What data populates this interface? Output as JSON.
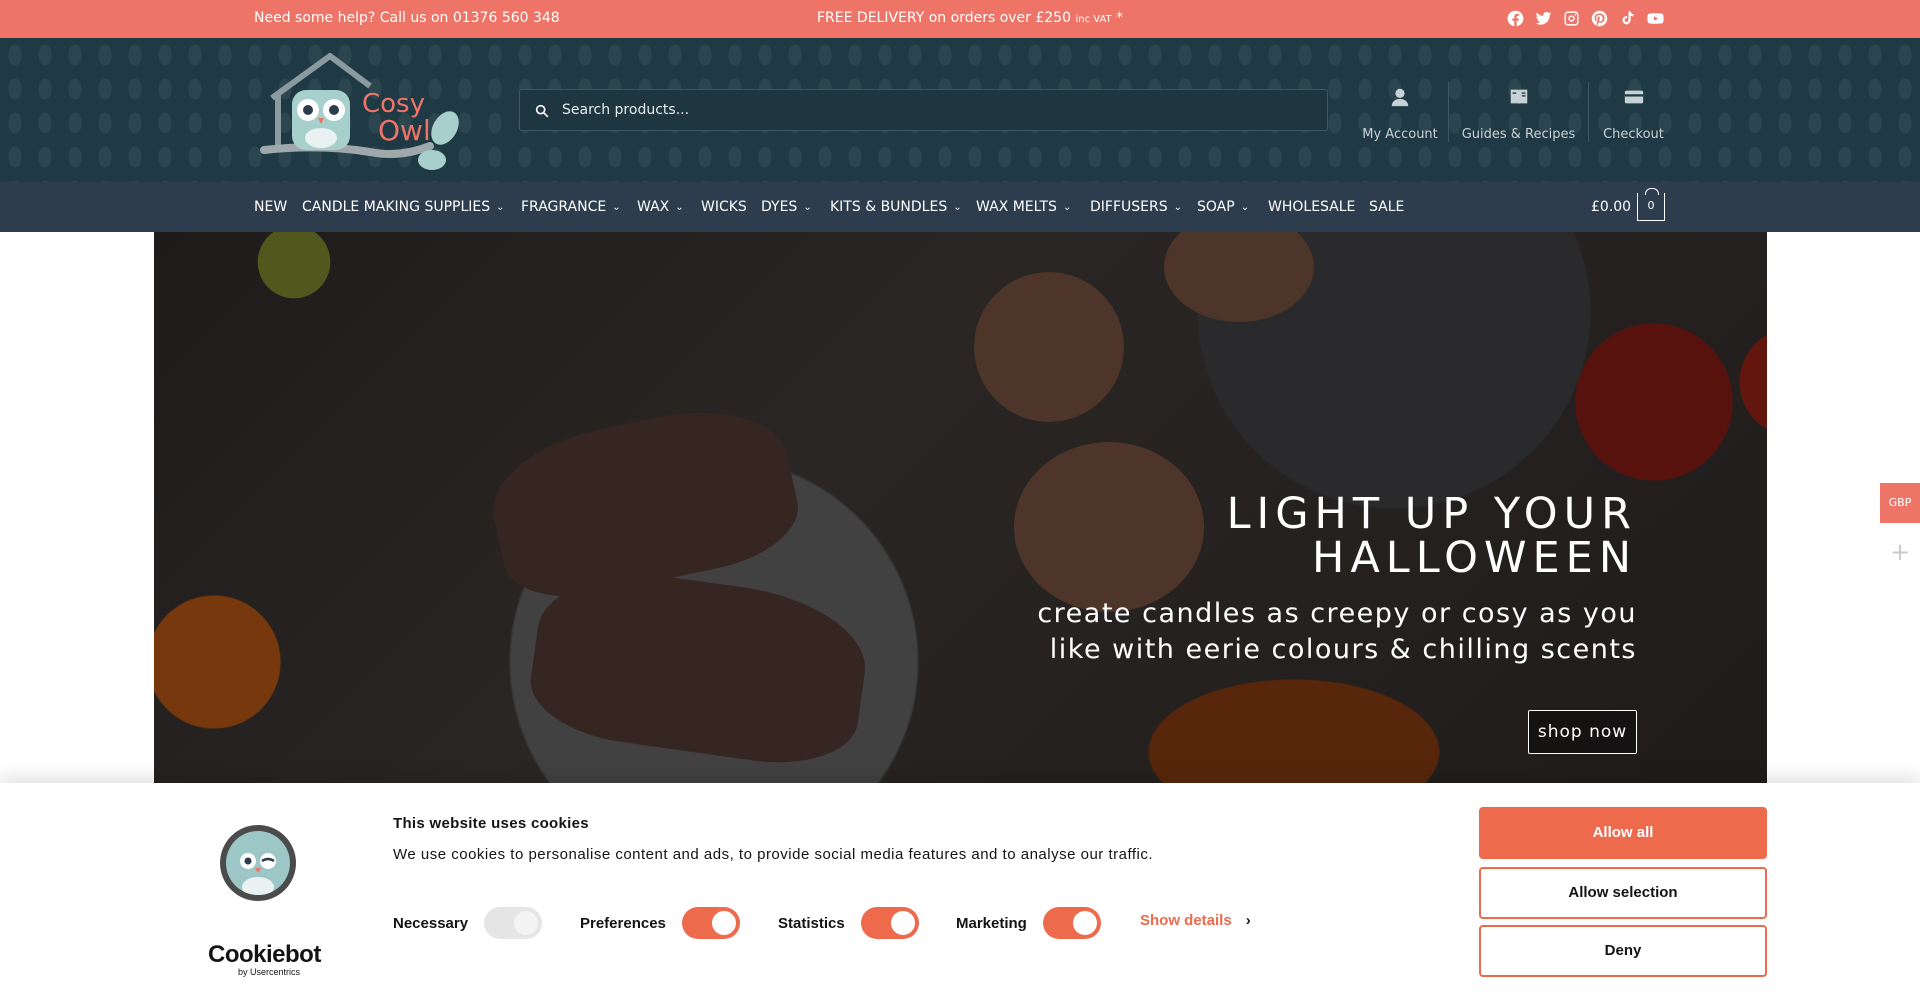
{
  "topbar": {
    "help_text": "Need some help? Call us on 01376 560 348",
    "delivery_text": "FREE DELIVERY on orders over £250",
    "delivery_small": "inc VAT",
    "delivery_star": "*",
    "socials": [
      "facebook-icon",
      "twitter-icon",
      "instagram-icon",
      "pinterest-icon",
      "tiktok-icon",
      "youtube-icon"
    ]
  },
  "logo": {
    "line1": "Cosy",
    "line2": "Owl"
  },
  "search": {
    "placeholder": "Search products..."
  },
  "header_links": [
    {
      "label": "My Account",
      "icon": "user-icon"
    },
    {
      "label": "Guides & Recipes",
      "icon": "book-icon"
    },
    {
      "label": "Checkout",
      "icon": "card-icon"
    }
  ],
  "nav": {
    "items": [
      {
        "label": "NEW",
        "has_dropdown": false
      },
      {
        "label": "CANDLE MAKING SUPPLIES",
        "has_dropdown": true
      },
      {
        "label": "FRAGRANCE",
        "has_dropdown": true
      },
      {
        "label": "WAX",
        "has_dropdown": true
      },
      {
        "label": "WICKS",
        "has_dropdown": false
      },
      {
        "label": "DYES",
        "has_dropdown": true
      },
      {
        "label": "KITS & BUNDLES",
        "has_dropdown": true
      },
      {
        "label": "WAX MELTS",
        "has_dropdown": true
      },
      {
        "label": "DIFFUSERS",
        "has_dropdown": true
      },
      {
        "label": "SOAP",
        "has_dropdown": true
      },
      {
        "label": "WHOLESALE",
        "has_dropdown": false
      },
      {
        "label": "SALE",
        "has_dropdown": false
      }
    ],
    "cart_total": "£0.00",
    "cart_count": "0"
  },
  "hero": {
    "headline_line1": "LIGHT UP YOUR",
    "headline_line2": "HALLOWEEN",
    "sub_line1": "create candles as creepy or cosy as you",
    "sub_line2": "like with eerie colours & chilling scents",
    "cta": "shop now"
  },
  "currency": {
    "label": "GBP",
    "plus": "+"
  },
  "cookie_banner": {
    "title": "This website uses cookies",
    "text": "We use cookies to personalise content and ads, to provide social media features and to analyse our traffic.",
    "toggles": [
      {
        "label": "Necessary",
        "state": "on-disabled"
      },
      {
        "label": "Preferences",
        "state": "on"
      },
      {
        "label": "Statistics",
        "state": "on"
      },
      {
        "label": "Marketing",
        "state": "on"
      }
    ],
    "show_details": "Show details",
    "buttons": {
      "allow_all": "Allow all",
      "allow_selection": "Allow selection",
      "deny": "Deny"
    },
    "brand": "Cookiebot",
    "brand_sub": "by Usercentrics"
  },
  "colors": {
    "accent": "#ee7468",
    "header": "#1f3a44",
    "nav": "#2e3d4d",
    "cookie_accent": "#ee6a4d"
  }
}
